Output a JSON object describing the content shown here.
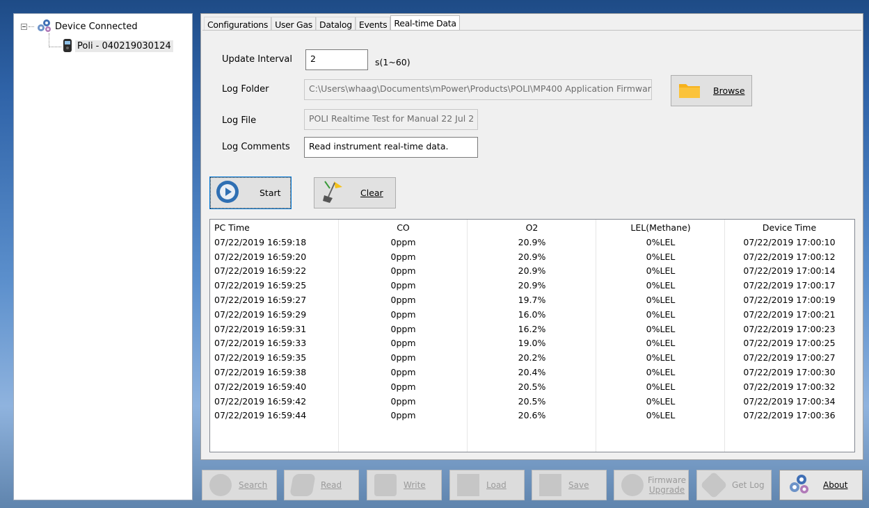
{
  "tree": {
    "root_label": "Device Connected",
    "child_label": "Poli - 040219030124"
  },
  "tabs": [
    {
      "label": "Configurations"
    },
    {
      "label": "User Gas"
    },
    {
      "label": "Datalog"
    },
    {
      "label": "Events"
    },
    {
      "label": "Real-time Data"
    }
  ],
  "form": {
    "update_interval_label": "Update Interval",
    "update_interval_value": "2",
    "update_interval_unit": "s(1~60)",
    "log_folder_label": "Log Folder",
    "log_folder_value": "C:\\Users\\whaag\\Documents\\mPower\\Products\\POLI\\MP400 Application Firmwar",
    "log_file_label": "Log File",
    "log_file_value": "POLI Realtime Test for Manual 22 Jul 2",
    "log_comments_label": "Log Comments",
    "log_comments_value": "Read instrument real-time data.",
    "browse_label": "Browse",
    "start_label": "Start",
    "clear_label": "Clear"
  },
  "table": {
    "headers": [
      "PC Time",
      "CO",
      "O2",
      "LEL(Methane)",
      "Device Time"
    ],
    "rows": [
      [
        "07/22/2019 16:59:18",
        "0ppm",
        "20.9%",
        "0%LEL",
        "07/22/2019 17:00:10"
      ],
      [
        "07/22/2019 16:59:20",
        "0ppm",
        "20.9%",
        "0%LEL",
        "07/22/2019 17:00:12"
      ],
      [
        "07/22/2019 16:59:22",
        "0ppm",
        "20.9%",
        "0%LEL",
        "07/22/2019 17:00:14"
      ],
      [
        "07/22/2019 16:59:25",
        "0ppm",
        "20.9%",
        "0%LEL",
        "07/22/2019 17:00:17"
      ],
      [
        "07/22/2019 16:59:27",
        "0ppm",
        "19.7%",
        "0%LEL",
        "07/22/2019 17:00:19"
      ],
      [
        "07/22/2019 16:59:29",
        "0ppm",
        "16.0%",
        "0%LEL",
        "07/22/2019 17:00:21"
      ],
      [
        "07/22/2019 16:59:31",
        "0ppm",
        "16.2%",
        "0%LEL",
        "07/22/2019 17:00:23"
      ],
      [
        "07/22/2019 16:59:33",
        "0ppm",
        "19.0%",
        "0%LEL",
        "07/22/2019 17:00:25"
      ],
      [
        "07/22/2019 16:59:35",
        "0ppm",
        "20.2%",
        "0%LEL",
        "07/22/2019 17:00:27"
      ],
      [
        "07/22/2019 16:59:38",
        "0ppm",
        "20.4%",
        "0%LEL",
        "07/22/2019 17:00:30"
      ],
      [
        "07/22/2019 16:59:40",
        "0ppm",
        "20.5%",
        "0%LEL",
        "07/22/2019 17:00:32"
      ],
      [
        "07/22/2019 16:59:42",
        "0ppm",
        "20.5%",
        "0%LEL",
        "07/22/2019 17:00:34"
      ],
      [
        "07/22/2019 16:59:44",
        "0ppm",
        "20.6%",
        "0%LEL",
        "07/22/2019 17:00:36"
      ]
    ]
  },
  "toolbar": {
    "search": "Search",
    "read": "Read",
    "write": "Write",
    "load": "Load",
    "save": "Save",
    "firmware_line1": "Firmware",
    "firmware_line2": "Upgrade",
    "getlog": "Get Log",
    "about": "About"
  },
  "colors": {
    "folder_icon": "#f7b21c",
    "start_icon": "#2f6fb3",
    "background_sky": "#5b8fcc"
  }
}
